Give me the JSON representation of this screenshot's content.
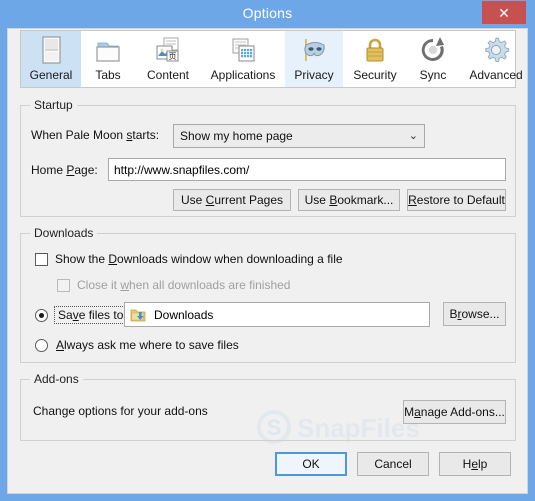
{
  "window": {
    "title": "Options",
    "close_label": "✕"
  },
  "tabs": [
    {
      "label": "General",
      "icon": "document-page-icon",
      "state": "selected"
    },
    {
      "label": "Tabs",
      "icon": "folder-tabs-icon",
      "state": "normal"
    },
    {
      "label": "Content",
      "icon": "content-image-icon",
      "state": "normal"
    },
    {
      "label": "Applications",
      "icon": "applications-grid-icon",
      "state": "normal"
    },
    {
      "label": "Privacy",
      "icon": "privacy-mask-icon",
      "state": "hover"
    },
    {
      "label": "Security",
      "icon": "security-lock-icon",
      "state": "normal"
    },
    {
      "label": "Sync",
      "icon": "sync-arrows-icon",
      "state": "normal"
    },
    {
      "label": "Advanced",
      "icon": "advanced-gear-icon",
      "state": "normal"
    }
  ],
  "startup": {
    "group_title": "Startup",
    "when_starts_label_pre": "When Pale Moon ",
    "when_starts_label_acc": "s",
    "when_starts_label_post": "tarts:",
    "startup_select_value": "Show my home page",
    "startup_select_caret": "⌄",
    "home_page_label_pre": "Home ",
    "home_page_label_acc": "P",
    "home_page_label_post": "age:",
    "home_page_value": "http://www.snapfiles.com/",
    "use_current_pages_pre": "Use ",
    "use_current_pages_acc": "C",
    "use_current_pages_post": "urrent Pages",
    "use_bookmark_pre": "Use ",
    "use_bookmark_acc": "B",
    "use_bookmark_post": "ookmark...",
    "restore_default_pre": "",
    "restore_default_acc": "R",
    "restore_default_post": "estore to Default"
  },
  "downloads": {
    "group_title": "Downloads",
    "show_window_pre": "Show the ",
    "show_window_acc": "D",
    "show_window_post": "ownloads window when downloading a file",
    "show_window_checked": false,
    "close_when_finished_pre": "Close it ",
    "close_when_finished_acc": "w",
    "close_when_finished_post": "hen all downloads are finished",
    "close_when_finished_checked": false,
    "close_when_finished_disabled": true,
    "save_files_to_pre": "Sa",
    "save_files_to_acc": "v",
    "save_files_to_post": "e files to",
    "save_files_to_selected": true,
    "folder_value": "Downloads",
    "folder_icon": "downloads-folder-icon",
    "browse_pre": "B",
    "browse_acc": "r",
    "browse_post": "owse...",
    "always_ask_pre": "",
    "always_ask_acc": "A",
    "always_ask_post": "lways ask me where to save files",
    "always_ask_selected": false
  },
  "addons": {
    "group_title": "Add-ons",
    "description": "Change options for your add-ons",
    "manage_pre": "M",
    "manage_acc": "a",
    "manage_post": "nage Add-ons..."
  },
  "footer": {
    "ok_label": "OK",
    "cancel_label": "Cancel",
    "help_pre": "H",
    "help_acc": "e",
    "help_post": "lp"
  },
  "watermark": {
    "text": "SnapFiles",
    "logo_letter": "S"
  },
  "colors": {
    "window_frame": "#6ea7e7",
    "close_button": "#c75050",
    "client_bg": "#f0f0f0",
    "tab_selected": "#cde1f4",
    "tab_hover": "#e6f1fb",
    "default_button_border": "#4a9ae0"
  }
}
